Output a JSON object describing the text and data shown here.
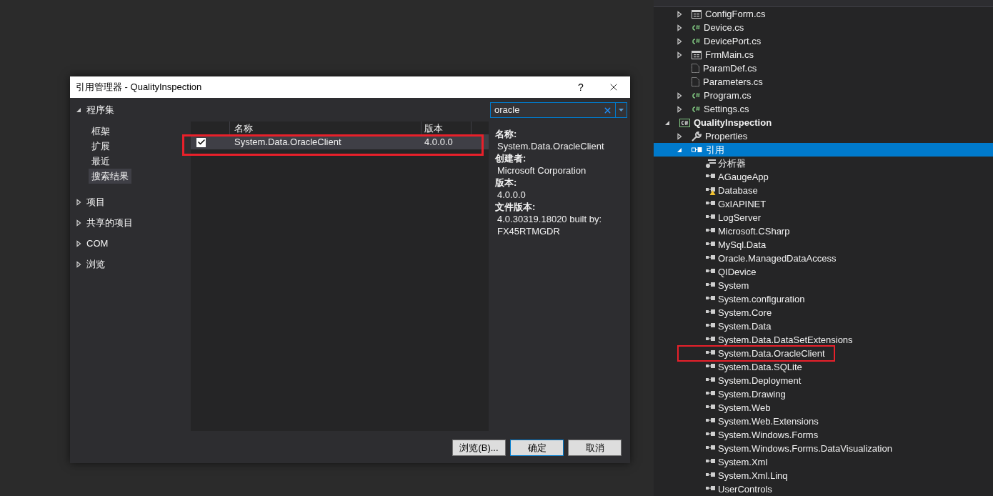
{
  "dialog": {
    "title": "引用管理器 - QualityInspection",
    "help": "?",
    "nav": [
      {
        "label": "程序集",
        "expanded": true,
        "children": [
          {
            "label": "框架",
            "selected": false
          },
          {
            "label": "扩展",
            "selected": false
          },
          {
            "label": "最近",
            "selected": false
          },
          {
            "label": "搜索结果",
            "selected": true
          }
        ]
      },
      {
        "label": "项目",
        "expanded": false
      },
      {
        "label": "共享的项目",
        "expanded": false
      },
      {
        "label": "COM",
        "expanded": false
      },
      {
        "label": "浏览",
        "expanded": false
      }
    ],
    "table": {
      "columns": [
        "名称",
        "版本"
      ],
      "rows": [
        {
          "checked": true,
          "selected": true,
          "highlighted": true,
          "name": "System.Data.OracleClient",
          "version": "4.0.0.0"
        }
      ]
    },
    "search": {
      "value": "oracle"
    },
    "details": [
      {
        "label": "名称:",
        "value": "System.Data.OracleClient"
      },
      {
        "label": "创建者:",
        "value": "Microsoft Corporation"
      },
      {
        "label": "版本:",
        "value": "4.0.0.0"
      },
      {
        "label": "文件版本:",
        "value": "4.0.30319.18020 built by: FX45RTMGDR"
      }
    ],
    "buttons": [
      {
        "label": "浏览(B)...",
        "default": false
      },
      {
        "label": "确定",
        "default": true
      },
      {
        "label": "取消",
        "default": false
      }
    ]
  },
  "solution_explorer": {
    "upper_items": [
      {
        "label": "ConfigForm.cs",
        "kind": "form",
        "expanded": false
      },
      {
        "label": "Device.cs",
        "kind": "csharp",
        "expanded": false
      },
      {
        "label": "DevicePort.cs",
        "kind": "csharp",
        "expanded": false
      },
      {
        "label": "FrmMain.cs",
        "kind": "form",
        "expanded": false
      },
      {
        "label": "ParamDef.cs",
        "kind": "file"
      },
      {
        "label": "Parameters.cs",
        "kind": "file"
      },
      {
        "label": "Program.cs",
        "kind": "csharp",
        "expanded": false
      },
      {
        "label": "Settings.cs",
        "kind": "csharp",
        "expanded": false
      }
    ],
    "tree": [
      {
        "label": "QualityInspection",
        "kind": "project",
        "expanded": true,
        "children": [
          {
            "label": "Properties",
            "kind": "wrench",
            "expanded": false
          },
          {
            "label": "引用",
            "kind": "references",
            "expanded": true,
            "selected": true,
            "children": [
              {
                "label": "分析器",
                "kind": "analyzer"
              },
              {
                "label": "AGaugeApp",
                "kind": "reference"
              },
              {
                "label": "Database",
                "kind": "reference_warning"
              },
              {
                "label": "GxIAPINET",
                "kind": "reference"
              },
              {
                "label": "LogServer",
                "kind": "reference"
              },
              {
                "label": "Microsoft.CSharp",
                "kind": "reference"
              },
              {
                "label": "MySql.Data",
                "kind": "reference"
              },
              {
                "label": "Oracle.ManagedDataAccess",
                "kind": "reference"
              },
              {
                "label": "QIDevice",
                "kind": "reference"
              },
              {
                "label": "System",
                "kind": "reference"
              },
              {
                "label": "System.configuration",
                "kind": "reference"
              },
              {
                "label": "System.Core",
                "kind": "reference"
              },
              {
                "label": "System.Data",
                "kind": "reference"
              },
              {
                "label": "System.Data.DataSetExtensions",
                "kind": "reference"
              },
              {
                "label": "System.Data.OracleClient",
                "kind": "reference",
                "highlighted": true
              },
              {
                "label": "System.Data.SQLite",
                "kind": "reference"
              },
              {
                "label": "System.Deployment",
                "kind": "reference"
              },
              {
                "label": "System.Drawing",
                "kind": "reference"
              },
              {
                "label": "System.Web",
                "kind": "reference"
              },
              {
                "label": "System.Web.Extensions",
                "kind": "reference"
              },
              {
                "label": "System.Windows.Forms",
                "kind": "reference"
              },
              {
                "label": "System.Windows.Forms.DataVisualization",
                "kind": "reference"
              },
              {
                "label": "System.Xml",
                "kind": "reference"
              },
              {
                "label": "System.Xml.Linq",
                "kind": "reference"
              },
              {
                "label": "UserControls",
                "kind": "reference"
              }
            ]
          }
        ]
      }
    ]
  }
}
